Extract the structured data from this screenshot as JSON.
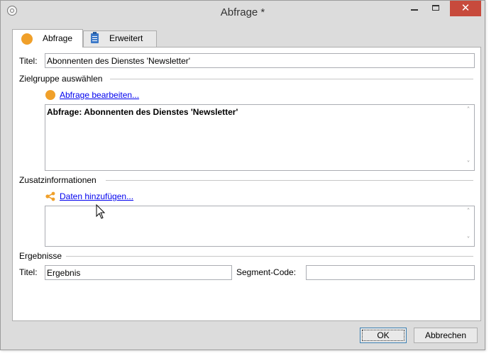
{
  "window": {
    "title": "Abfrage *",
    "close_glyph": "✕"
  },
  "tabs": [
    {
      "label": "Abfrage",
      "icon": "orange-circle-icon",
      "active": true
    },
    {
      "label": "Erweitert",
      "icon": "clipboard-icon",
      "active": false
    }
  ],
  "form": {
    "title_label": "Titel:",
    "title_value": "Abonnenten des Dienstes 'Newsletter'",
    "target_section": "Zielgruppe auswählen",
    "edit_query_link": "Abfrage bearbeiten...",
    "query_summary": "Abfrage: Abonnenten des Dienstes 'Newsletter'",
    "extra_section": "Zusatzinformationen",
    "add_data_link": "Daten hinzufügen...",
    "results_section": "Ergebnisse",
    "result_title_label": "Titel:",
    "result_title_value": "Ergebnis",
    "segment_code_label": "Segment-Code:",
    "segment_code_value": ""
  },
  "buttons": {
    "ok": "OK",
    "cancel": "Abbrechen"
  },
  "colors": {
    "accent_orange": "#f0a02a",
    "link": "#0000ee",
    "close_button": "#c74a3c"
  }
}
